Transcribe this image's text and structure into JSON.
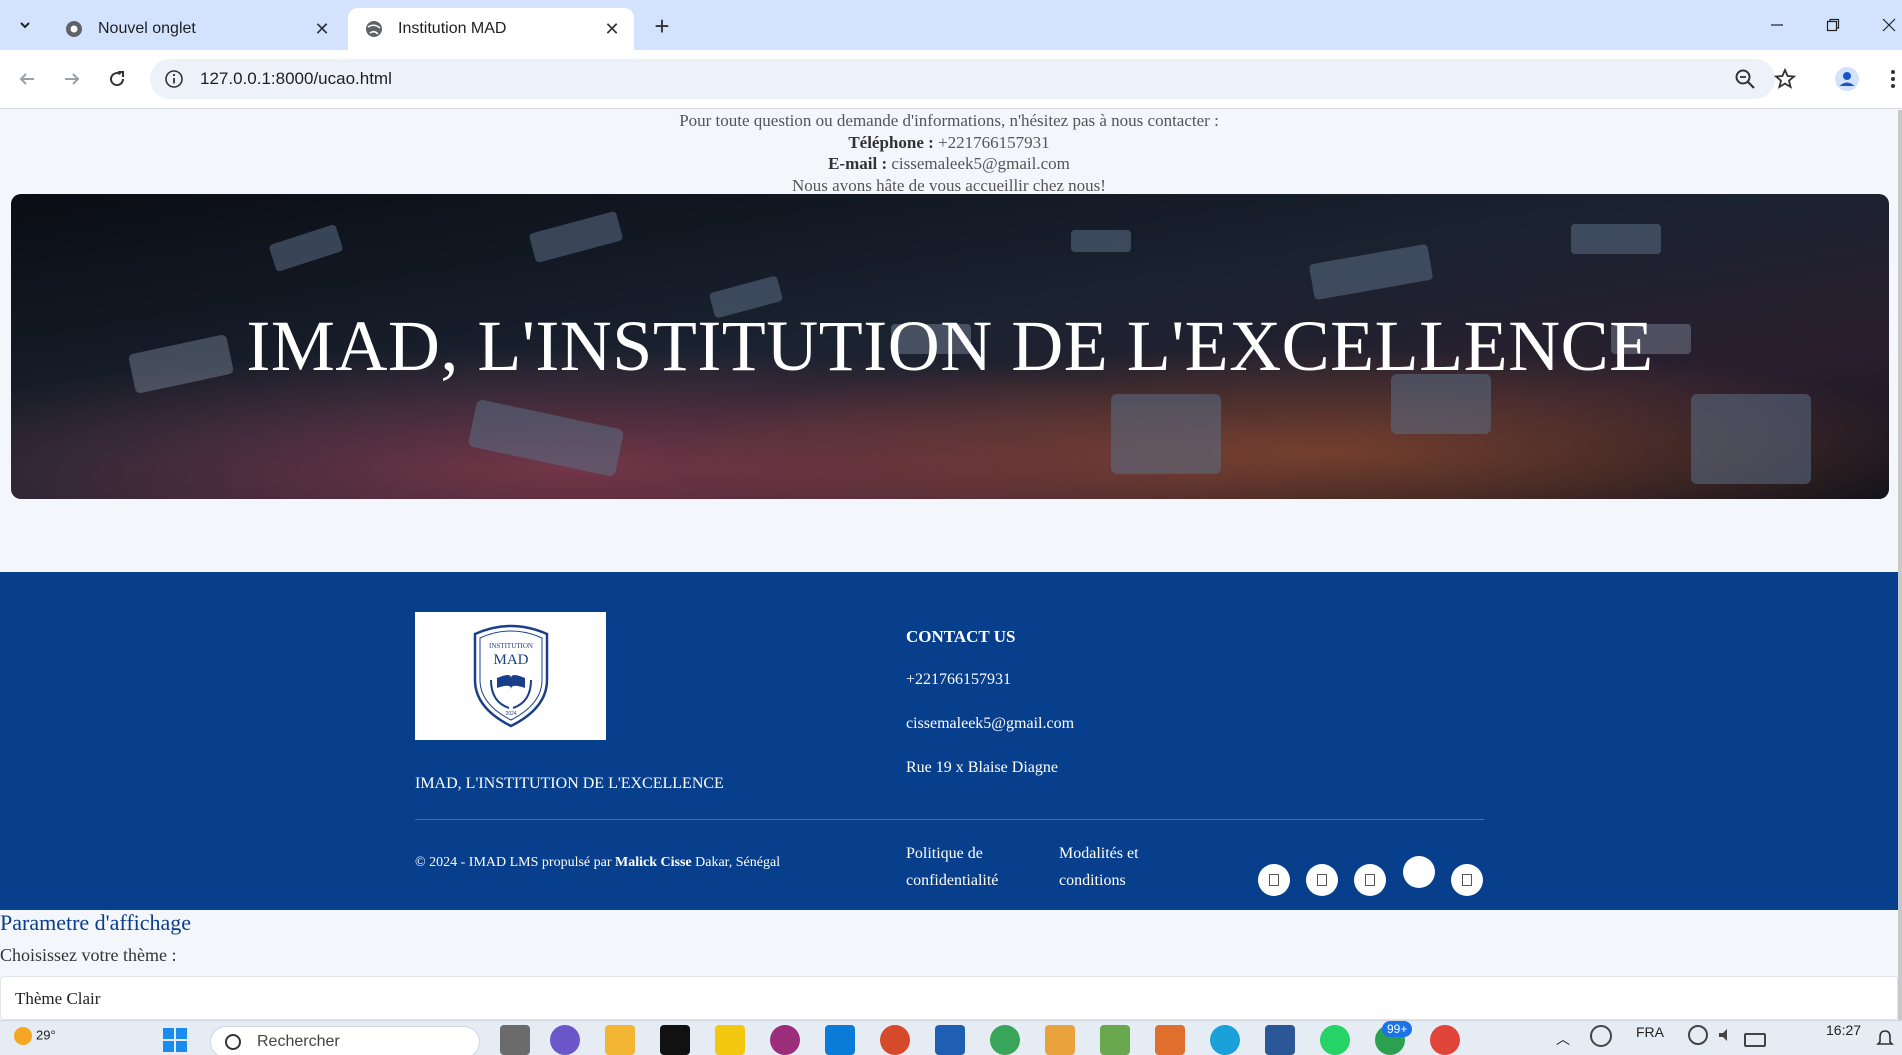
{
  "browser": {
    "tabs": [
      {
        "title": "Nouvel onglet",
        "active": false
      },
      {
        "title": "Institution MAD",
        "active": true
      }
    ],
    "url": "127.0.0.1:8000/ucao.html"
  },
  "intro": {
    "line1": "Pour toute question ou demande d'informations, n'hésitez pas à nous contacter :",
    "phone_label": "Téléphone :",
    "phone_value": "+221766157931",
    "email_label": "E-mail :",
    "email_value": "cissemaleek5@gmail.com",
    "closing": "Nous avons hâte de vous accueillir chez nous!"
  },
  "hero": {
    "title": "IMAD, L'INSTITUTION DE L'EXCELLENCE"
  },
  "footer": {
    "logo_text_top": "INSTITUTION",
    "logo_text_main": "MAD",
    "logo_year": "2024",
    "brand_name": "IMAD, L'INSTITUTION DE L'EXCELLENCE",
    "contact_heading": "CONTACT US",
    "contact_phone": "+221766157931",
    "contact_email": "cissemaleek5@gmail.com",
    "contact_address": "Rue 19 x Blaise Diagne",
    "copyright_prefix": "© 2024 - IMAD LMS propulsé par",
    "copyright_author": "Malick Cisse",
    "copyright_suffix": "Dakar, Sénégal",
    "privacy_line1": "Politique de",
    "privacy_line2": "confidentialité",
    "terms_line1": "Modalités et",
    "terms_line2": "conditions",
    "social_icons": [
      "facebook-icon",
      "twitter-icon",
      "instagram-icon",
      "linkedin-icon",
      "youtube-icon"
    ]
  },
  "settings": {
    "title": "Parametre d'affichage",
    "label": "Choisissez votre thème :",
    "selected_theme": "Thème Clair"
  },
  "taskbar": {
    "temperature": "29°",
    "search_placeholder": "Rechercher",
    "notification_count": "99+",
    "language": "FRA",
    "time": "16:27"
  },
  "colors": {
    "footer_bg": "#073f8c",
    "tabbar_bg": "#d3e3fd",
    "page_bg": "#f3f6fb"
  }
}
